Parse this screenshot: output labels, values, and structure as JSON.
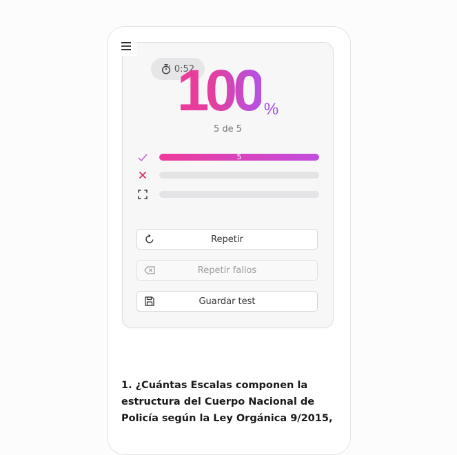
{
  "menu": {
    "icon": "hamburger-menu-icon"
  },
  "timer": {
    "icon": "stopwatch-icon",
    "value": "0:52"
  },
  "score": {
    "value": "100",
    "unit": "%",
    "summary": "5 de 5"
  },
  "stats": [
    {
      "name": "correct",
      "icon": "check-icon",
      "color": "#c24ee0",
      "fraction": 1.0,
      "label": "5"
    },
    {
      "name": "incorrect",
      "icon": "x-icon",
      "color": "#d0245c",
      "fraction": 0,
      "label": ""
    },
    {
      "name": "unanswered",
      "icon": "focus-frame-icon",
      "color": "#333333",
      "fraction": 0,
      "label": ""
    }
  ],
  "actions": {
    "repeat_label": "Repetir",
    "repeat_icon": "refresh-icon",
    "repeat_failures_label": "Repetir fallos",
    "repeat_failures_icon": "backspace-icon",
    "save_label": "Guardar test",
    "save_icon": "floppy-disk-icon"
  },
  "question": {
    "line1": "1. ¿Cuántas Escalas componen la",
    "line2": "estructura del Cuerpo Nacional de",
    "line3": "Policía según la Ley Orgánica 9/2015,"
  },
  "colors": {
    "accent_pink": "#ee3a9a",
    "accent_purple": "#b452e6",
    "error_red": "#d0245c"
  }
}
